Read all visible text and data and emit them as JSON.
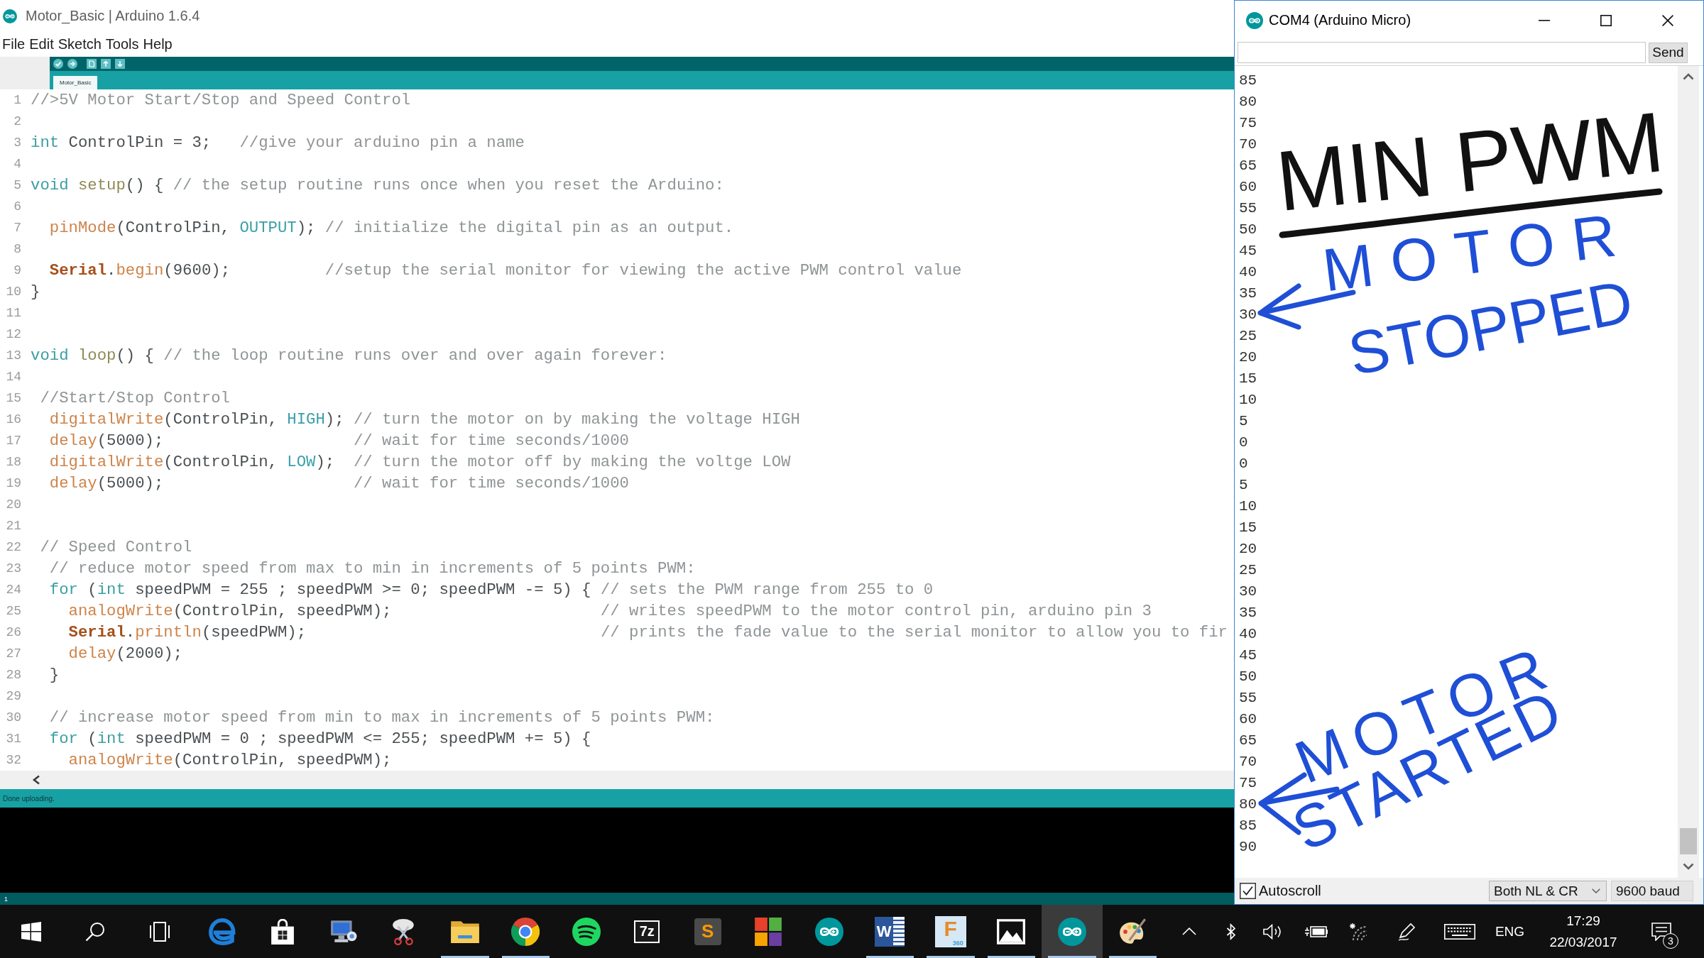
{
  "editor_window": {
    "title": "Motor_Basic | Arduino 1.6.4",
    "menu": [
      "File",
      "Edit",
      "Sketch",
      "Tools",
      "Help"
    ],
    "tabs": [
      {
        "label": "Motor_Basic",
        "selected": true
      }
    ],
    "lines": [
      {
        "number": "1",
        "tokens": [
          {
            "kind": "comment",
            "text": "//>5V Motor Start/Stop and Speed Control"
          }
        ]
      },
      {
        "number": "2"
      },
      {
        "number": "3",
        "tokens": [
          {
            "kind": "type",
            "text": "int"
          },
          {
            "kind": "plain",
            "text": " ControlPin = 3;   "
          },
          {
            "kind": "comment",
            "text": "//give your arduino pin a name"
          }
        ]
      },
      {
        "number": "4"
      },
      {
        "number": "5",
        "tokens": [
          {
            "kind": "type",
            "text": "void "
          },
          {
            "kind": "structure",
            "text": "setup"
          },
          {
            "kind": "plain",
            "text": "() { "
          },
          {
            "kind": "comment",
            "text": "// the setup routine runs once when you reset the Arduino:"
          }
        ]
      },
      {
        "number": "6"
      },
      {
        "number": "7",
        "tokens": [
          {
            "kind": "function",
            "text": "  pinMode"
          },
          {
            "kind": "plain",
            "text": "(ControlPin, "
          },
          {
            "kind": "constant",
            "text": "OUTPUT"
          },
          {
            "kind": "plain",
            "text": "); "
          },
          {
            "kind": "comment",
            "text": "// initialize the digital pin as an output."
          }
        ]
      },
      {
        "number": "8"
      },
      {
        "number": "9",
        "tokens": [
          {
            "kind": "object",
            "text": "  Serial"
          },
          {
            "kind": "plain",
            "text": "."
          },
          {
            "kind": "function",
            "text": "begin"
          },
          {
            "kind": "plain",
            "text": "(9600);          "
          },
          {
            "kind": "comment",
            "text": "//setup the serial monitor for viewing the active PWM control value"
          }
        ]
      },
      {
        "number": "10",
        "tokens": [
          {
            "kind": "plain",
            "text": "}"
          }
        ]
      },
      {
        "number": "11"
      },
      {
        "number": "12"
      },
      {
        "number": "13",
        "tokens": [
          {
            "kind": "type",
            "text": "void "
          },
          {
            "kind": "structure",
            "text": "loop"
          },
          {
            "kind": "plain",
            "text": "() { "
          },
          {
            "kind": "comment",
            "text": "// the loop routine runs over and over again forever:"
          }
        ]
      },
      {
        "number": "14"
      },
      {
        "number": "15",
        "tokens": [
          {
            "kind": "comment",
            "text": " //Start/Stop Control"
          }
        ]
      },
      {
        "number": "16",
        "tokens": [
          {
            "kind": "function",
            "text": "  digitalWrite"
          },
          {
            "kind": "plain",
            "text": "(ControlPin, "
          },
          {
            "kind": "constant",
            "text": "HIGH"
          },
          {
            "kind": "plain",
            "text": "); "
          },
          {
            "kind": "comment",
            "text": "// turn the motor on by making the voltage HIGH"
          }
        ]
      },
      {
        "number": "17",
        "tokens": [
          {
            "kind": "function",
            "text": "  delay"
          },
          {
            "kind": "plain",
            "text": "(5000);                    "
          },
          {
            "kind": "comment",
            "text": "// wait for time seconds/1000"
          }
        ]
      },
      {
        "number": "18",
        "tokens": [
          {
            "kind": "function",
            "text": "  digitalWrite"
          },
          {
            "kind": "plain",
            "text": "(ControlPin, "
          },
          {
            "kind": "constant",
            "text": "LOW"
          },
          {
            "kind": "plain",
            "text": ");  "
          },
          {
            "kind": "comment",
            "text": "// turn the motor off by making the voltge LOW"
          }
        ]
      },
      {
        "number": "19",
        "tokens": [
          {
            "kind": "function",
            "text": "  delay"
          },
          {
            "kind": "plain",
            "text": "(5000);                    "
          },
          {
            "kind": "comment",
            "text": "// wait for time seconds/1000"
          }
        ]
      },
      {
        "number": "20"
      },
      {
        "number": "21"
      },
      {
        "number": "22",
        "tokens": [
          {
            "kind": "comment",
            "text": " // Speed Control"
          }
        ]
      },
      {
        "number": "23",
        "tokens": [
          {
            "kind": "comment",
            "text": "  // reduce motor speed from max to min in increments of 5 points PWM:"
          }
        ]
      },
      {
        "number": "24",
        "tokens": [
          {
            "kind": "type",
            "text": "  for"
          },
          {
            "kind": "plain",
            "text": " ("
          },
          {
            "kind": "type",
            "text": "int"
          },
          {
            "kind": "plain",
            "text": " speedPWM = 255 ; speedPWM >= 0; speedPWM -= 5) { "
          },
          {
            "kind": "comment",
            "text": "// sets the PWM range from 255 to 0"
          }
        ]
      },
      {
        "number": "25",
        "tokens": [
          {
            "kind": "function",
            "text": "    analogWrite"
          },
          {
            "kind": "plain",
            "text": "(ControlPin, speedPWM);                      "
          },
          {
            "kind": "comment",
            "text": "// writes speedPWM to the motor control pin, arduino pin 3"
          }
        ]
      },
      {
        "number": "26",
        "tokens": [
          {
            "kind": "object",
            "text": "    Serial"
          },
          {
            "kind": "plain",
            "text": "."
          },
          {
            "kind": "function",
            "text": "println"
          },
          {
            "kind": "plain",
            "text": "(speedPWM);                               "
          },
          {
            "kind": "comment",
            "text": "// prints the fade value to the serial monitor to allow you to fir"
          }
        ]
      },
      {
        "number": "27",
        "tokens": [
          {
            "kind": "function",
            "text": "    delay"
          },
          {
            "kind": "plain",
            "text": "(2000);"
          }
        ]
      },
      {
        "number": "28",
        "tokens": [
          {
            "kind": "plain",
            "text": "  }"
          }
        ]
      },
      {
        "number": "29"
      },
      {
        "number": "30",
        "tokens": [
          {
            "kind": "comment",
            "text": "  // increase motor speed from min to max in increments of 5 points PWM:"
          }
        ]
      },
      {
        "number": "31",
        "tokens": [
          {
            "kind": "type",
            "text": "  for"
          },
          {
            "kind": "plain",
            "text": " ("
          },
          {
            "kind": "type",
            "text": "int"
          },
          {
            "kind": "plain",
            "text": " speedPWM = 0 ; speedPWM <= 255; speedPWM += 5) {"
          }
        ]
      },
      {
        "number": "32",
        "tokens": [
          {
            "kind": "function",
            "text": "    analogWrite"
          },
          {
            "kind": "plain",
            "text": "(ControlPin, speedPWM);"
          }
        ]
      }
    ],
    "status": "Done uploading.",
    "cursor_line": "1"
  },
  "serial_monitor": {
    "title": "COM4 (Arduino Micro)",
    "send_button": "Send",
    "output": [
      "85",
      "80",
      "75",
      "70",
      "65",
      "60",
      "55",
      "50",
      "45",
      "40",
      "35",
      "30",
      "25",
      "20",
      "15",
      "10",
      "5",
      "0",
      "0",
      "5",
      "10",
      "15",
      "20",
      "25",
      "30",
      "35",
      "40",
      "45",
      "50",
      "55",
      "60",
      "65",
      "70",
      "75",
      "80",
      "85",
      "90"
    ],
    "annotations": [
      {
        "kind": "title",
        "lines": [
          "MIN PWM"
        ],
        "color": "#111111"
      },
      {
        "kind": "note",
        "lines": [
          "MOTOR",
          "STOPPED"
        ],
        "color": "#1f4fd6"
      },
      {
        "kind": "note",
        "lines": [
          "MOTOR",
          "STARTED"
        ],
        "color": "#1f4fd6"
      }
    ],
    "autoscroll": {
      "label": "Autoscroll",
      "checked": true
    },
    "line_ending": "Both NL & CR",
    "baud_rate": "9600 baud"
  },
  "taskbar": {
    "apps": [
      {
        "kind": "start",
        "selected": false,
        "running": false
      },
      {
        "kind": "search",
        "selected": false,
        "running": false
      },
      {
        "kind": "taskview",
        "selected": false,
        "running": false
      },
      {
        "kind": "browser",
        "selected": false,
        "running": false
      },
      {
        "kind": "store",
        "selected": false,
        "running": false
      },
      {
        "kind": "computer",
        "selected": false,
        "running": false
      },
      {
        "kind": "scissors",
        "selected": false,
        "running": false
      },
      {
        "kind": "folder",
        "selected": false,
        "running": true
      },
      {
        "kind": "ring",
        "selected": false,
        "running": true
      },
      {
        "kind": "waves",
        "selected": false,
        "running": false
      },
      {
        "kind": "archive",
        "label": "7z",
        "selected": false,
        "running": false
      },
      {
        "kind": "editor",
        "label": "S",
        "selected": false,
        "running": false
      },
      {
        "kind": "mosaic",
        "selected": false,
        "running": false
      },
      {
        "kind": "infinity",
        "selected": false,
        "running": false
      },
      {
        "kind": "document",
        "label": "W",
        "selected": false,
        "running": true
      },
      {
        "kind": "cad",
        "label": "F",
        "caption": "360",
        "selected": false,
        "running": true
      },
      {
        "kind": "photos",
        "selected": false,
        "running": true
      },
      {
        "kind": "infinity",
        "selected": true,
        "running": true
      },
      {
        "kind": "palette",
        "selected": false,
        "running": true
      }
    ],
    "language": "ENG",
    "time": "17:29",
    "date": "22/03/2017",
    "notification_count": "3"
  }
}
